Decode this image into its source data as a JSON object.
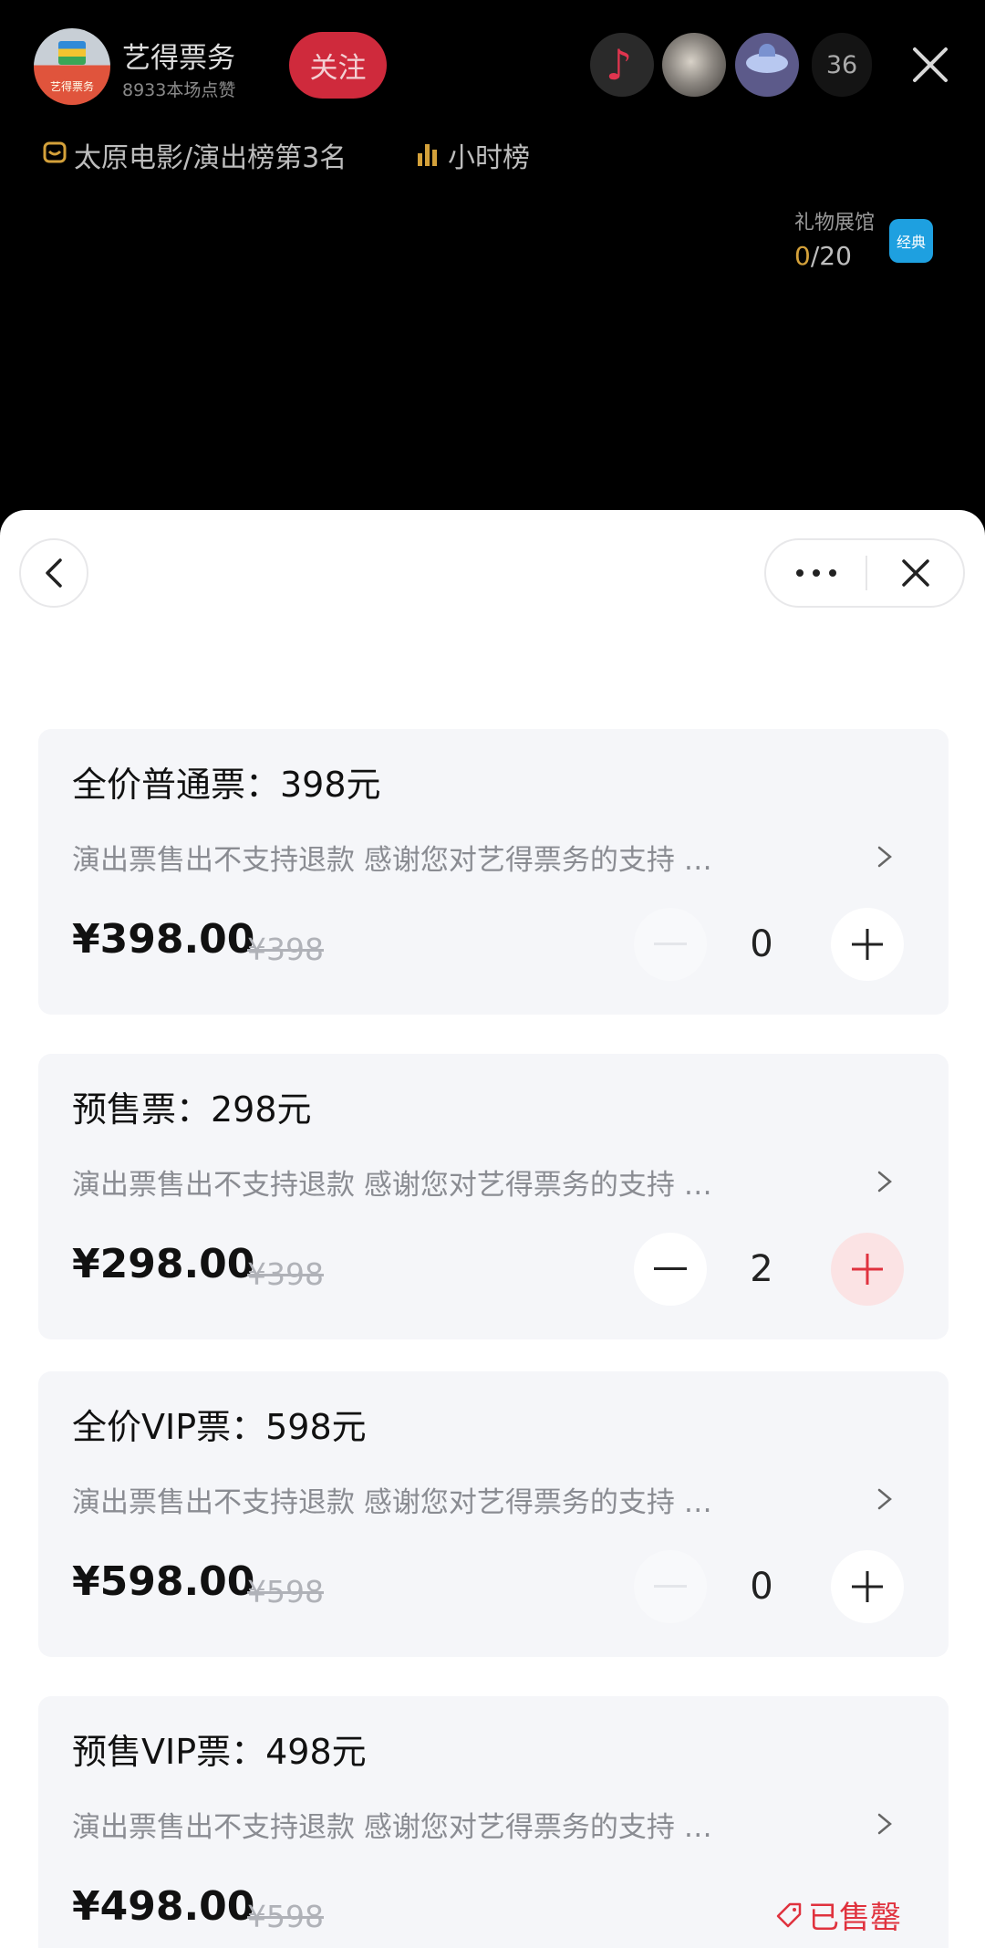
{
  "live": {
    "anchor_name": "艺得票务",
    "anchor_logo_text": "艺得票务",
    "likes": "8933本场点赞",
    "follow_label": "关注",
    "viewer_count": "36",
    "rank_text": "太原电影/演出榜第3名",
    "hour_rank_label": "小时榜",
    "gift_gallery": {
      "label": "礼物展馆",
      "current": "0",
      "total": "/20",
      "badge": "经典"
    }
  },
  "tickets": [
    {
      "title": "全价普通票：398元",
      "note": "演出票售出不支持退款 感谢您对艺得票务的支持 …",
      "price": "¥398.00",
      "original_price": "¥398",
      "quantity": "0",
      "state": "available"
    },
    {
      "title": "预售票：298元",
      "note": "演出票售出不支持退款 感谢您对艺得票务的支持 …",
      "price": "¥298.00",
      "original_price": "¥398",
      "quantity": "2",
      "state": "available"
    },
    {
      "title": "全价VIP票：598元",
      "note": "演出票售出不支持退款 感谢您对艺得票务的支持 …",
      "price": "¥598.00",
      "original_price": "¥598",
      "quantity": "0",
      "state": "available"
    },
    {
      "title": "预售VIP票：498元",
      "note": "演出票售出不支持退款 感谢您对艺得票务的支持 …",
      "price": "¥498.00",
      "original_price": "¥598",
      "sold_out_label": "已售罄",
      "state": "sold_out"
    }
  ],
  "colors": {
    "accent_red": "#e0323e",
    "follow_red": "#cf2a3c",
    "rank_gold": "#d4a13a",
    "card_bg": "#f5f6f9"
  }
}
